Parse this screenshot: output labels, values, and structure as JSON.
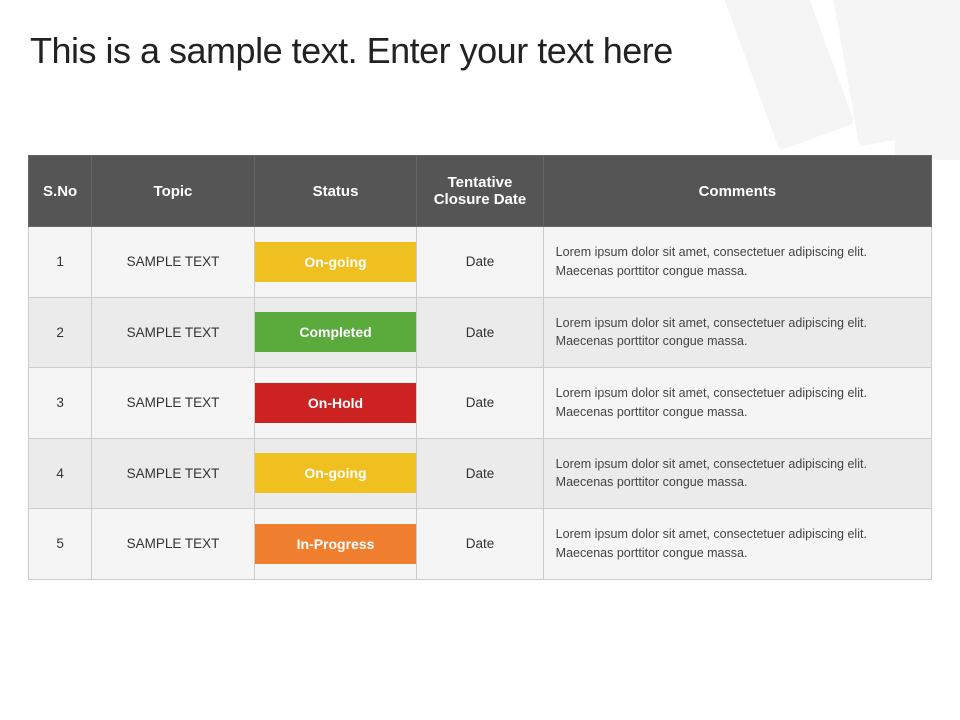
{
  "page": {
    "title": "This is a sample text. Enter your text here"
  },
  "table": {
    "headers": {
      "sno": "S.No",
      "topic": "Topic",
      "status": "Status",
      "tentative_closure_date": "Tentative Closure Date",
      "comments": "Comments"
    },
    "rows": [
      {
        "sno": "1",
        "topic": "SAMPLE TEXT",
        "status": "On-going",
        "status_type": "ongoing",
        "date": "Date",
        "comments": "Lorem ipsum dolor sit amet, consectetuer adipiscing elit. Maecenas porttitor congue massa."
      },
      {
        "sno": "2",
        "topic": "SAMPLE TEXT",
        "status": "Completed",
        "status_type": "completed",
        "date": "Date",
        "comments": "Lorem ipsum dolor sit amet, consectetuer adipiscing elit. Maecenas porttitor congue massa."
      },
      {
        "sno": "3",
        "topic": "SAMPLE TEXT",
        "status": "On-Hold",
        "status_type": "onhold",
        "date": "Date",
        "comments": "Lorem ipsum dolor sit amet, consectetuer adipiscing elit. Maecenas porttitor congue massa."
      },
      {
        "sno": "4",
        "topic": "SAMPLE TEXT",
        "status": "On-going",
        "status_type": "ongoing",
        "date": "Date",
        "comments": "Lorem ipsum dolor sit amet, consectetuer adipiscing elit. Maecenas porttitor congue massa."
      },
      {
        "sno": "5",
        "topic": "SAMPLE TEXT",
        "status": "In-Progress",
        "status_type": "inprogress",
        "date": "Date",
        "comments": "Lorem ipsum dolor sit amet, consectetuer adipiscing elit. Maecenas porttitor congue massa."
      }
    ]
  }
}
